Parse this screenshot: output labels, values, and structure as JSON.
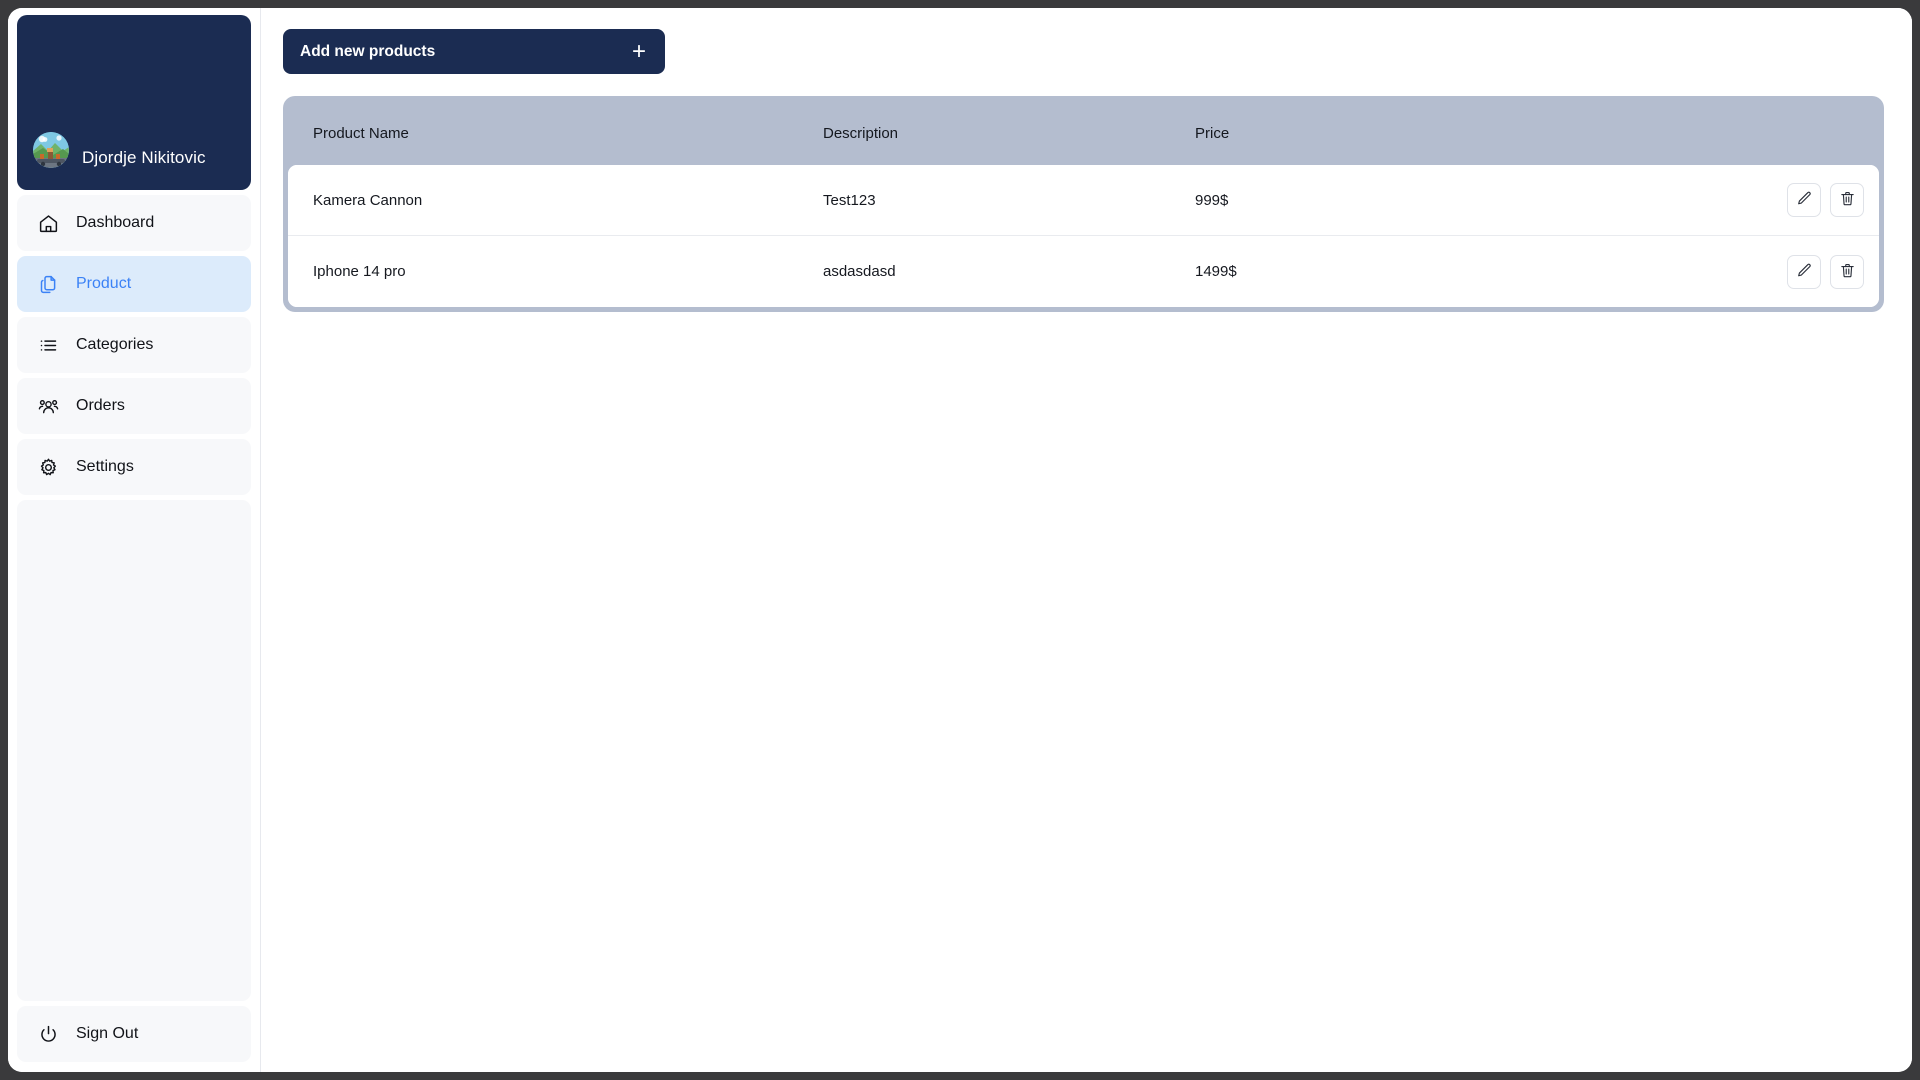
{
  "window": {
    "background_color": "#3a3a3c",
    "page_background": "#ffffff"
  },
  "sidebar": {
    "profile": {
      "name": "Djordje Nikitovic",
      "avatar_icon": "user-avatar-image",
      "card_color": "#1b2c52"
    },
    "items": [
      {
        "label": "Dashboard",
        "icon": "home-icon",
        "active": false
      },
      {
        "label": "Product",
        "icon": "documents-icon",
        "active": true
      },
      {
        "label": "Categories",
        "icon": "list-icon",
        "active": false
      },
      {
        "label": "Orders",
        "icon": "people-icon",
        "active": false
      },
      {
        "label": "Settings",
        "icon": "gear-icon",
        "active": false
      }
    ],
    "sign_out": {
      "label": "Sign Out",
      "icon": "power-icon"
    },
    "active_color": "#3b82f6",
    "active_background": "#dcebfb",
    "item_background": "#f7f8fa"
  },
  "main": {
    "add_button": {
      "label": "Add new products",
      "icon": "plus-icon",
      "color": "#1b2c52"
    },
    "table": {
      "header_background": "#b4bdcf",
      "columns": [
        "Product Name",
        "Description",
        "Price"
      ],
      "rows": [
        {
          "name": "Kamera Cannon",
          "description": "Test123",
          "price": "999$",
          "edit_icon": "pencil-icon",
          "delete_icon": "trash-icon"
        },
        {
          "name": "Iphone 14 pro",
          "description": "asdasdasd",
          "price": "1499$",
          "edit_icon": "pencil-icon",
          "delete_icon": "trash-icon"
        }
      ]
    }
  }
}
